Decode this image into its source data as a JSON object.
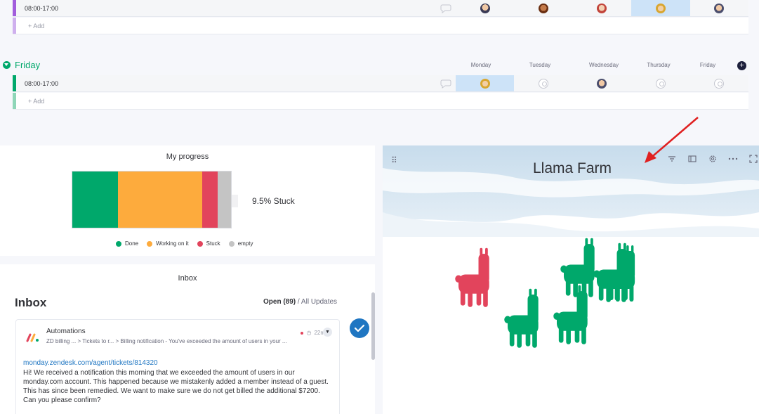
{
  "top_group": {
    "row_time": "08:00-17:00",
    "add_label": "+ Add",
    "color": "#a25ddc"
  },
  "friday_group": {
    "title": "Friday",
    "color": "#00a86b",
    "columns": [
      "Monday",
      "Tuesday",
      "Wednesday",
      "Thursday",
      "Friday"
    ],
    "row_time": "08:00-17:00",
    "add_label": "+ Add"
  },
  "progress_widget": {
    "title": "My progress",
    "stuck_label": "9.5% Stuck",
    "legend": [
      {
        "label": "Done",
        "color": "#00a86b"
      },
      {
        "label": "Working on it",
        "color": "#fdab3d"
      },
      {
        "label": "Stuck",
        "color": "#e2445c"
      },
      {
        "label": "empty",
        "color": "#c4c4c4"
      }
    ]
  },
  "chart_data": {
    "type": "bar",
    "categories": [
      "Done",
      "Working on it",
      "Stuck",
      "empty"
    ],
    "values": [
      28.6,
      53.4,
      9.5,
      8.5
    ],
    "title": "My progress",
    "xlabel": "",
    "ylabel": ""
  },
  "inbox_widget": {
    "widget_title": "Inbox",
    "heading": "Inbox",
    "tab_open": "Open (89)",
    "tab_separator": " / ",
    "tab_all": "All Updates",
    "card": {
      "sender": "Automations",
      "crumbs": "ZD billing ... > Tickets to r... > Billing notification - You've exceeded the amount of users in your ...",
      "time": "22m",
      "link": "monday.zendesk.com/agent/tickets/814320",
      "body": "Hi! We received a notification this morning that we exceeded the amount of users in our monday.com account. This happened because we mistakenly added a member instead of a guest. This has since been remedied. We want to make sure we do not get billed the additional $7200. Can you please confirm?"
    }
  },
  "llama_widget": {
    "title": "Llama Farm",
    "colors": {
      "stuck": "#e2445c",
      "done": "#00a86b",
      "snow": "#dbe9f3"
    }
  }
}
